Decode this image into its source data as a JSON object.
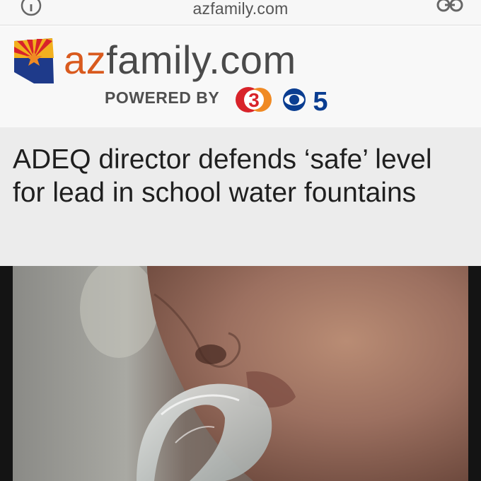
{
  "browser": {
    "url": "azfamily.com",
    "icons": {
      "info": "info-icon",
      "share": "link-icon"
    }
  },
  "masthead": {
    "brand_az": "az",
    "brand_rest": "family.com",
    "powered_by": "POWERED BY",
    "channel_3": "3",
    "channel_5": "5",
    "colors": {
      "az_orange": "#d95a1e",
      "ch3_red": "#d8232a",
      "cbs_blue": "#0a3d91"
    }
  },
  "article": {
    "headline": "ADEQ director defends ‘safe’ level for lead in school water fountains"
  }
}
